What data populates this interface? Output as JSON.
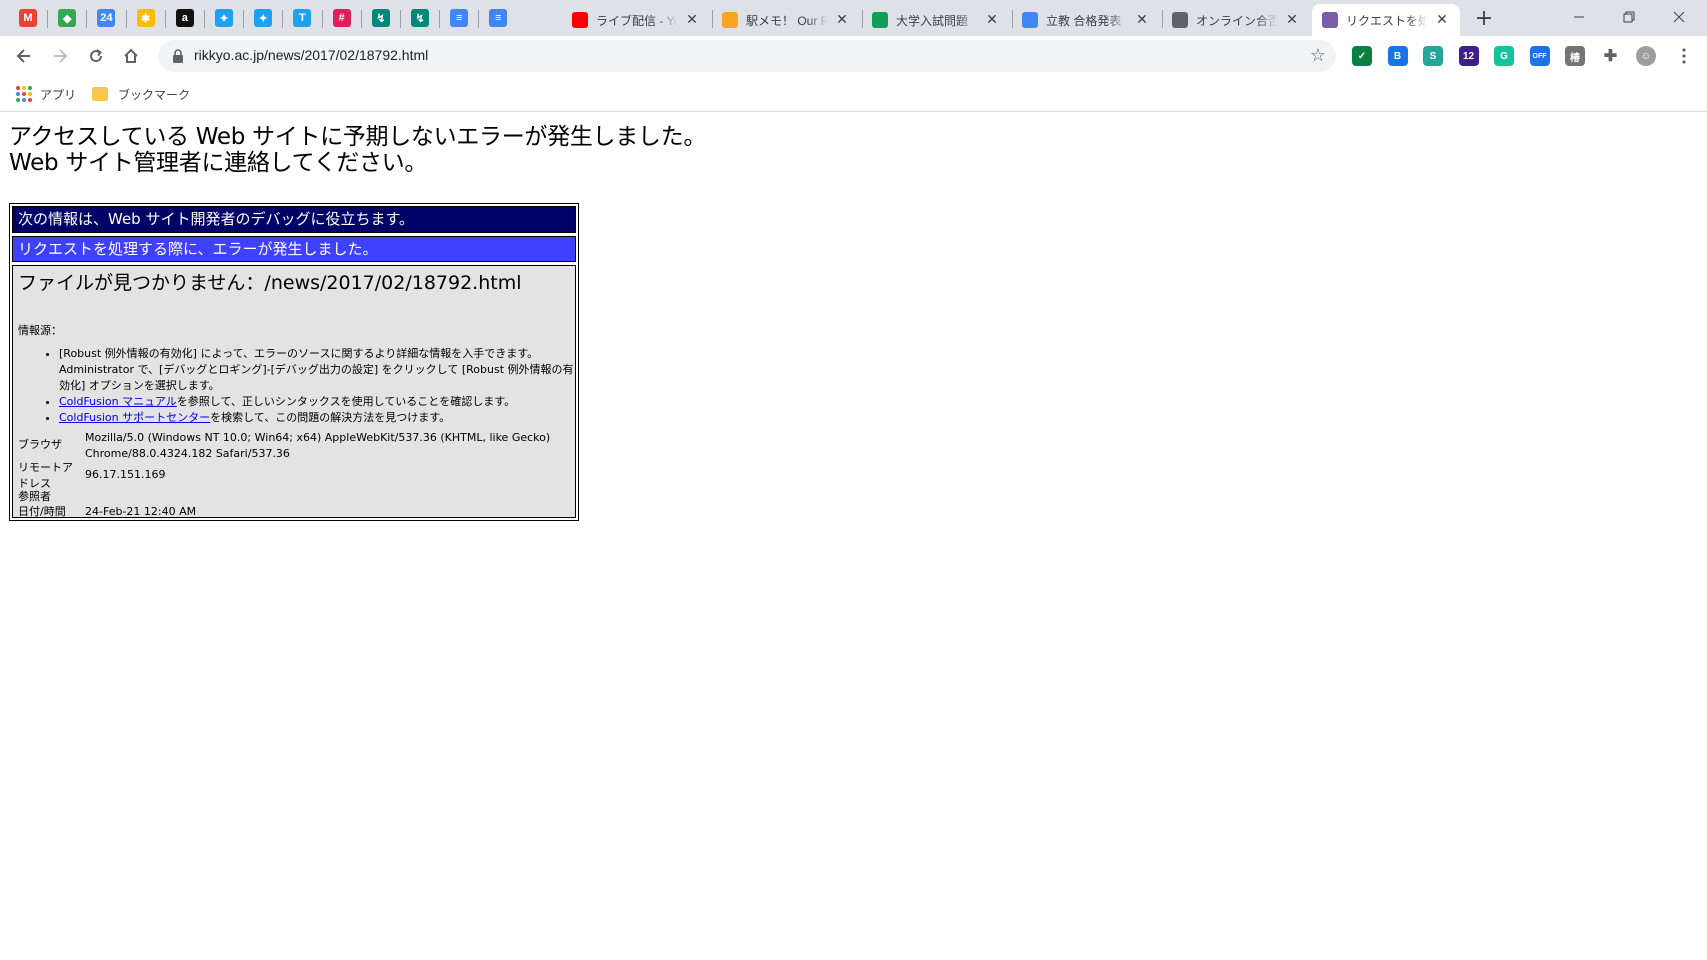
{
  "browser": {
    "pinned_tabs": [
      {
        "name": "gmail",
        "icon": "gmail-icon",
        "color": "#ea4335",
        "glyph": "M"
      },
      {
        "name": "maps",
        "icon": "maps-pin-icon",
        "color": "#34a853",
        "glyph": "◆"
      },
      {
        "name": "calendar",
        "icon": "calendar-icon",
        "color": "#4285f4",
        "glyph": "24"
      },
      {
        "name": "photos",
        "icon": "pinwheel-icon",
        "color": "#fbbc05",
        "glyph": "✱"
      },
      {
        "name": "amazon",
        "icon": "amazon-icon",
        "color": "#111111",
        "glyph": "a"
      },
      {
        "name": "twitter",
        "icon": "twitter-icon",
        "color": "#1da1f2",
        "glyph": "✦"
      },
      {
        "name": "twitter-square",
        "icon": "twitter-square-icon",
        "color": "#1da1f2",
        "glyph": "✦"
      },
      {
        "name": "tweetdeck",
        "icon": "tweetdeck-icon",
        "color": "#1da1f2",
        "glyph": "T"
      },
      {
        "name": "slack",
        "icon": "slack-icon",
        "color": "#e01e5a",
        "glyph": "#"
      },
      {
        "name": "app-a",
        "icon": "spark-icon",
        "color": "#00897b",
        "glyph": "↯"
      },
      {
        "name": "app-b",
        "icon": "spark-icon",
        "color": "#00897b",
        "glyph": "↯"
      },
      {
        "name": "docs-a",
        "icon": "docs-icon",
        "color": "#4285f4",
        "glyph": "≡"
      },
      {
        "name": "docs-b",
        "icon": "docs-icon",
        "color": "#4285f4",
        "glyph": "≡"
      }
    ],
    "tabs": [
      {
        "title": "ライブ配信 - YouTube",
        "icon": "youtube-icon",
        "color": "#ff0000",
        "active": false
      },
      {
        "title": "駅メモ！ Our Rails",
        "icon": "ekimemo-icon",
        "color": "#f6a623",
        "active": false
      },
      {
        "title": "大学入試問題",
        "icon": "sheets-icon",
        "color": "#0f9d58",
        "active": false
      },
      {
        "title": "立教 合格発表",
        "icon": "google-icon",
        "color": "#4285f4",
        "active": false
      },
      {
        "title": "オンライン合否照会",
        "icon": "globe-icon",
        "color": "#5f6368",
        "active": false
      },
      {
        "title": "リクエストを処理する際に",
        "icon": "coldfusion-icon",
        "color": "#7b5ea7",
        "active": true
      }
    ],
    "url": "rikkyo.ac.jp/news/2017/02/18792.html",
    "extensions": [
      {
        "icon": "shield-icon",
        "color": "#0b8043",
        "glyph": "✓"
      },
      {
        "icon": "bookmark-ext-icon",
        "color": "#1a73e8",
        "glyph": "B"
      },
      {
        "icon": "s-ext-icon",
        "color": "#26a69a",
        "glyph": "S"
      },
      {
        "icon": "graduation-icon",
        "color": "#3f1f8c",
        "glyph": "12"
      },
      {
        "icon": "grammarly-icon",
        "color": "#15c39a",
        "glyph": "G"
      },
      {
        "icon": "meet-off-icon",
        "color": "#1a73e8",
        "glyph": "OFF"
      },
      {
        "icon": "kanji-ext-icon",
        "color": "#757575",
        "glyph": "椿"
      },
      {
        "icon": "puzzle-icon",
        "color": "#5f6368",
        "glyph": "✚"
      },
      {
        "icon": "avatar-icon",
        "color": "#9e9e9e",
        "glyph": "☺"
      }
    ],
    "bookmarks": {
      "apps_label": "アプリ",
      "folder_label": "ブックマーク"
    }
  },
  "page": {
    "heading_line1": "アクセスしている Web サイトに予期しないエラーが発生しました。",
    "heading_line2": "Web サイト管理者に連絡してください。",
    "debug_header": "次の情報は、Web サイト開発者のデバッグに役立ちます。",
    "error_bar": "リクエストを処理する際に、エラーが発生しました。",
    "error_title": "ファイルが見つかりません：/news/2017/02/18792.html",
    "source_label": "情報源：",
    "info_items": [
      {
        "text": "[Robust 例外情報の有効化] によって、エラーのソースに関するより詳細な情報を入手できます。Administrator で、[デバッグとロギング]-[デバッグ出力の設定] をクリックして [Robust 例外情報の有効化] オプションを選択します。",
        "link": "",
        "suffix": ""
      },
      {
        "text": "",
        "link": "ColdFusion マニュアル",
        "suffix": "を参照して、正しいシンタックスを使用していることを確認します。"
      },
      {
        "text": "",
        "link": "ColdFusion サポートセンター",
        "suffix": "を検索して、この問題の解決方法を見つけます。"
      }
    ],
    "details": {
      "browser_key": "ブラウザ",
      "browser_val": "Mozilla/5.0 (Windows NT 10.0; Win64; x64) AppleWebKit/537.36 (KHTML, like Gecko) Chrome/88.0.4324.182 Safari/537.36",
      "remote_key": "リモートアドレス",
      "remote_val": "96.17.151.169",
      "referrer_key": "参照者",
      "referrer_val": "",
      "datetime_key": "日付/時間",
      "datetime_val": "24-Feb-21 12:40 AM"
    }
  }
}
